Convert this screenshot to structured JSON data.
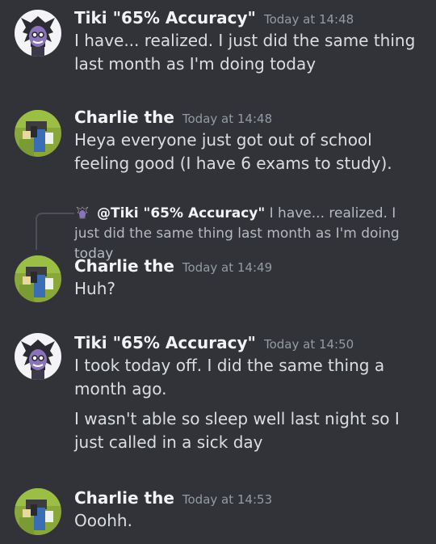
{
  "messages": [
    {
      "author": "Tiki \"65% Accuracy\"",
      "timestamp": "Today at 14:48",
      "avatar": "tiki-avatar",
      "lines": [
        "I have... realized. I just did the same thing last month as I'm doing today"
      ]
    },
    {
      "author": "Charlie the",
      "timestamp": "Today at 14:48",
      "avatar": "charlie-avatar",
      "lines": [
        "Heya everyone just got out of school feeling good (I have 6 exams to study)."
      ]
    },
    {
      "author": "Charlie the",
      "timestamp": "Today at 14:49",
      "avatar": "charlie-avatar",
      "reply": {
        "author": "@Tiki \"65% Accuracy\"",
        "text": "I have... realized. I just did the same thing last month as I'm doing today"
      },
      "lines": [
        "Huh?"
      ]
    },
    {
      "author": "Tiki \"65% Accuracy\"",
      "timestamp": "Today at 14:50",
      "avatar": "tiki-avatar",
      "lines": [
        "I took today off. I did the same thing a month ago.",
        "I wasn't able so sleep well last night so I just called in a sick day"
      ]
    },
    {
      "author": "Charlie the",
      "timestamp": "Today at 14:53",
      "avatar": "charlie-avatar",
      "lines": [
        "Ooohh."
      ]
    }
  ],
  "colors": {
    "background": "#313338",
    "username": "#f2f3f5",
    "timestamp": "#949ba4",
    "text": "#dbdee1"
  }
}
